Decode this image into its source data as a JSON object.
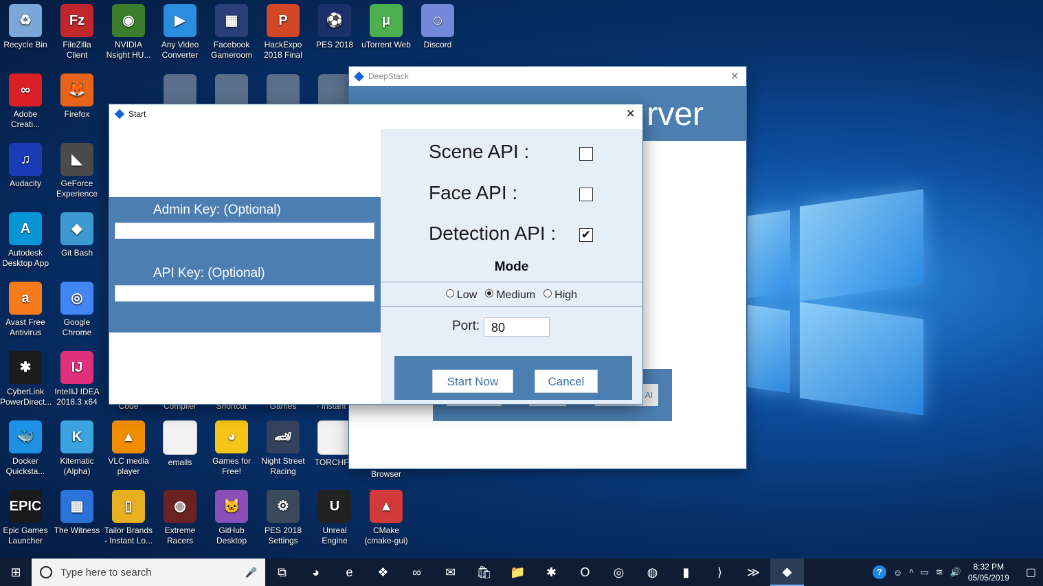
{
  "desktop": {
    "icons": [
      {
        "label": "Recycle Bin",
        "color": "#7aa7d8",
        "glyph": "♻"
      },
      {
        "label": "FileZilla Client",
        "color": "#c0272d",
        "glyph": "Fz"
      },
      {
        "label": "NVIDIA Nsight HU...",
        "color": "#3a7d2a",
        "glyph": "◉"
      },
      {
        "label": "Any Video Converter",
        "color": "#2a8de0",
        "glyph": "▶"
      },
      {
        "label": "Facebook Gameroom",
        "color": "#2a3f78",
        "glyph": "▦"
      },
      {
        "label": "HackExpo 2018 Final",
        "color": "#d24726",
        "glyph": "P"
      },
      {
        "label": "PES 2018",
        "color": "#1b2f6b",
        "glyph": "⚽"
      },
      {
        "label": "uTorrent Web",
        "color": "#4caf50",
        "glyph": "μ"
      },
      {
        "label": "Discord",
        "color": "#7289da",
        "glyph": "☺"
      },
      {
        "label": "Adobe Creati...",
        "color": "#da1f26",
        "glyph": "∞"
      },
      {
        "label": "Firefox",
        "color": "#e8641b",
        "glyph": "🦊"
      },
      {
        "label": "Audacity",
        "color": "#1a3bb3",
        "glyph": "♫"
      },
      {
        "label": "GeForce Experience",
        "color": "#4b4b4b",
        "glyph": "◣"
      },
      {
        "label": "Autodesk Desktop App",
        "color": "#0696d7",
        "glyph": "A"
      },
      {
        "label": "Git Bash",
        "color": "#3d9ad1",
        "glyph": "◆"
      },
      {
        "label": "Avast Free Antivirus",
        "color": "#f77b1c",
        "glyph": "a"
      },
      {
        "label": "Google Chrome",
        "color": "#4285f4",
        "glyph": "◎"
      },
      {
        "label": "CyberLink PowerDirect...",
        "color": "#1c1c1c",
        "glyph": "✱"
      },
      {
        "label": "IntelliJ IDEA 2018.3 x64",
        "color": "#e0307c",
        "glyph": "IJ"
      },
      {
        "label": "Docker Quicksta...",
        "color": "#1d91e6",
        "glyph": "🐳"
      },
      {
        "label": "Kitematic (Alpha)",
        "color": "#3aa3e0",
        "glyph": "K"
      },
      {
        "label": "VLC media player",
        "color": "#f08c00",
        "glyph": "▲"
      },
      {
        "label": "emails",
        "color": "#f2f2f2",
        "glyph": ""
      },
      {
        "label": "Games for Free!",
        "color": "#f5c518",
        "glyph": "◕"
      },
      {
        "label": "Night Street Racing",
        "color": "#34425e",
        "glyph": "🏎"
      },
      {
        "label": "TORCHFU",
        "color": "#f2f2f2",
        "glyph": ""
      },
      {
        "label": "Epic Games Launcher",
        "color": "#1a1a1a",
        "glyph": "EPIC"
      },
      {
        "label": "The Witness",
        "color": "#2a73d8",
        "glyph": "▦"
      },
      {
        "label": "Tailor Brands - Instant Lo...",
        "color": "#e8b020",
        "glyph": "▯"
      },
      {
        "label": "Extreme Racers",
        "color": "#6b2222",
        "glyph": "◍"
      },
      {
        "label": "GitHub Desktop",
        "color": "#8a4fb8",
        "glyph": "🐱"
      },
      {
        "label": "PES 2018 Settings",
        "color": "#3a4a5a",
        "glyph": "⚙"
      },
      {
        "label": "Unreal Engine",
        "color": "#222222",
        "glyph": "U"
      },
      {
        "label": "CMake (cmake-gui)",
        "color": "#d33b3b",
        "glyph": "▲"
      }
    ],
    "partial_labels": [
      "Code",
      "Compiler",
      "Shortcut",
      "Games",
      "- Instant L",
      "Browser"
    ]
  },
  "back_window": {
    "title": "DeepStack",
    "close_glyph": "✕",
    "banner_text": "rver",
    "mini_label": "AI"
  },
  "start_dialog": {
    "title": "Start",
    "close_glyph": "✕",
    "admin_key_label": "Admin Key: (Optional)",
    "admin_key_value": "",
    "api_key_label": "API Key: (Optional)",
    "api_key_value": "",
    "apis": [
      {
        "label": "Scene API :",
        "checked": false
      },
      {
        "label": "Face API :",
        "checked": false
      },
      {
        "label": "Detection API :",
        "checked": true
      }
    ],
    "checkmark_glyph": "✔",
    "mode_label": "Mode",
    "modes": [
      {
        "label": "Low",
        "selected": false
      },
      {
        "label": "Medium",
        "selected": true
      },
      {
        "label": "High",
        "selected": false
      }
    ],
    "port_label": "Port:",
    "port_value": "80",
    "start_button": "Start Now",
    "cancel_button": "Cancel"
  },
  "taskbar": {
    "start_glyph": "⊞",
    "search_placeholder": "Type here to search",
    "mic_glyph": "🎤",
    "apps": [
      {
        "name": "task-view",
        "glyph": "⧉"
      },
      {
        "name": "firefox",
        "glyph": "◕"
      },
      {
        "name": "edge",
        "glyph": "e"
      },
      {
        "name": "dropbox",
        "glyph": "❖"
      },
      {
        "name": "infinity",
        "glyph": "∞"
      },
      {
        "name": "mail",
        "glyph": "✉"
      },
      {
        "name": "store",
        "glyph": "🛍"
      },
      {
        "name": "file-explorer",
        "glyph": "📁"
      },
      {
        "name": "cyberlink",
        "glyph": "✱"
      },
      {
        "name": "opera",
        "glyph": "O"
      },
      {
        "name": "chrome",
        "glyph": "◎"
      },
      {
        "name": "browser",
        "glyph": "◍"
      },
      {
        "name": "sticky-notes",
        "glyph": "▮"
      },
      {
        "name": "vscode",
        "glyph": "⟩"
      },
      {
        "name": "powershell",
        "glyph": "≫"
      },
      {
        "name": "deepstack",
        "glyph": "◆"
      }
    ],
    "tray_glyphs": {
      "help": "?",
      "people": "☺",
      "chevron": "^",
      "battery": "▭",
      "wifi": "≋",
      "volume": "🔊",
      "notifications": "▢"
    },
    "time": "8:32 PM",
    "date": "05/05/2019"
  },
  "colors": {
    "panel_blue": "#4c7eb1",
    "light_panel": "#e6eef8",
    "accent": "#1565d8"
  }
}
